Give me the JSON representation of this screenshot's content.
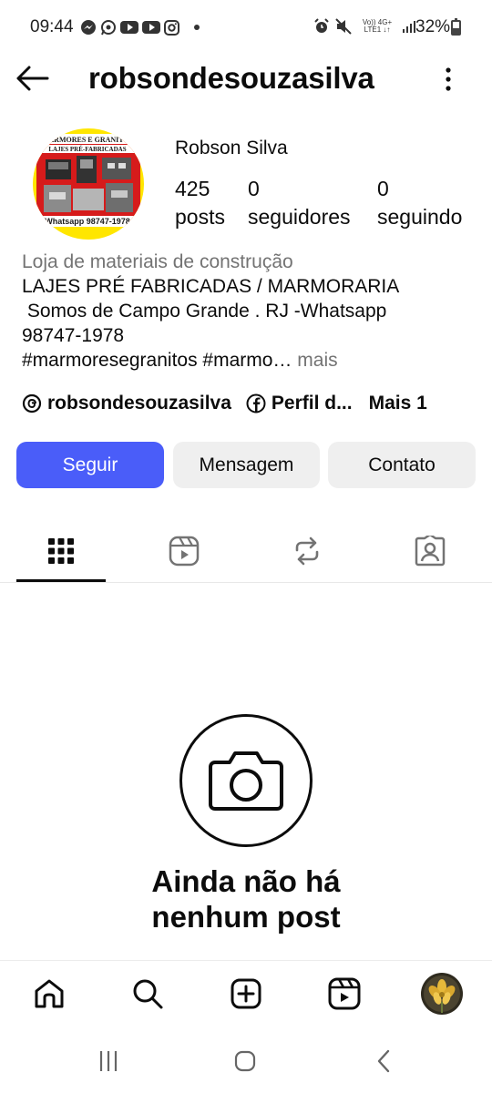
{
  "status_bar": {
    "time": "09:44",
    "battery": "32%",
    "network_top": "Vo)) 4G+",
    "network_bottom": "LTE1 ↓↑",
    "app_icons": [
      "messenger-icon",
      "whatsapp-icon",
      "youtube-icon",
      "youtube-icon",
      "instagram-icon"
    ],
    "right_icons": [
      "alarm-icon",
      "mute-icon",
      "signal-icon",
      "battery-icon"
    ]
  },
  "header": {
    "username": "robsondesouzasilva"
  },
  "profile": {
    "avatar_text_top": "MARMORES E GRANITOS",
    "avatar_text_sub": "LAJES PRÉ-FABRICADAS",
    "avatar_text_bottom": "Whatsapp 98747-1978",
    "full_name": "Robson Silva",
    "stats": [
      {
        "value": "425",
        "label": "posts"
      },
      {
        "value": "0",
        "label": "seguidores"
      },
      {
        "value": "0",
        "label": "seguindo"
      }
    ],
    "category": "Loja de materiais de construção",
    "bio_lines": [
      "LAJES PRÉ FABRICADAS / MARMORARIA",
      " Somos de Campo Grande . RJ -Whatsapp",
      "98747-1978",
      "#marmoresegranitos #marmo…"
    ],
    "bio_more": " mais",
    "links": {
      "threads": "robsondesouzasilva",
      "facebook": "Perfil d...",
      "more": "Mais 1"
    }
  },
  "actions": {
    "follow": "Seguir",
    "message": "Mensagem",
    "contact": "Contato"
  },
  "tabs": [
    "grid-icon",
    "reels-icon",
    "reposts-icon",
    "tagged-icon"
  ],
  "empty_state": {
    "line1": "Ainda não há",
    "line2": "nenhum post"
  },
  "bottom_nav": [
    "home-icon",
    "search-icon",
    "create-icon",
    "reels-icon",
    "profile-avatar"
  ],
  "colors": {
    "accent": "#4a5df9",
    "secondary_text": "#737373",
    "button_gray": "#efefef"
  }
}
